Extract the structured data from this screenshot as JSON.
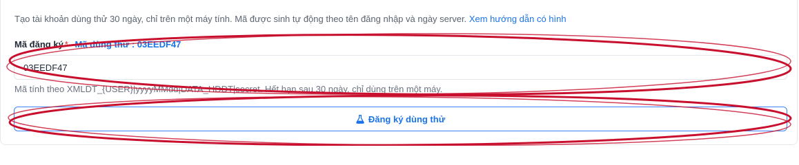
{
  "intro": {
    "text": "Tạo tài khoản dùng thử 30 ngày, chỉ trên một máy tính. Mã được sinh tự động theo tên đăng nhập và ngày server.",
    "link_label": "Xem hướng dẫn có hình"
  },
  "field": {
    "label": "Mã đăng ký",
    "required_mark": "*",
    "hint_prefix": "Mã dùng thử : ",
    "hint_code": "03EEDF47",
    "value": "03EEDF47",
    "help_text": "Mã tính theo XMLDT_{USER}|yyyyMMdd|DATA_HDDT|secret. Hết hạn sau 30 ngày, chỉ dùng trên một máy."
  },
  "button": {
    "label": "Đăng ký dùng thử",
    "icon": "flask-icon"
  },
  "colors": {
    "accent": "#1a73e8",
    "annotation": "#c8102e",
    "required": "#dc2626"
  }
}
